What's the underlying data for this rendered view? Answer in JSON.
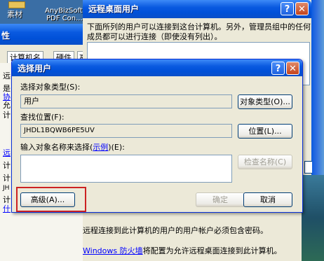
{
  "desktop": {
    "icons": [
      {
        "label": "素材"
      },
      {
        "label_line1": "AnyBizSoft",
        "label_line2": "PDF Con..."
      }
    ]
  },
  "back_window": {
    "title_fragment": "性",
    "tabs": [
      "计算机名",
      "硬件",
      "高"
    ],
    "fragments": [
      "远",
      "是",
      "协",
      "允",
      "计",
      "远",
      "计",
      "计",
      "JH",
      "计",
      "什"
    ]
  },
  "remote_window": {
    "title": "远程桌面用户",
    "help": "?",
    "close": "✕",
    "desc_line1": "下面所列的用户可以连接到这台计算机。另外，管理员组中的任何",
    "desc_line2": "成员都可以进行连接（即使没有列出）。",
    "bottom_line1": "远程连接到此计算机的用户的用户帐户必须包含密码。",
    "bottom_line2_link": "Windows 防火墙",
    "bottom_line2_rest": "将配置为允许远程桌面连接到此计算机。"
  },
  "select_user_dialog": {
    "title": "选择用户",
    "help": "?",
    "close": "✕",
    "object_type_label": "选择对象类型(S):",
    "object_type_value": "用户",
    "object_type_button": "对象类型(O)...",
    "location_label": "查找位置(F):",
    "location_value": "JHDL1BQWB6PE5UV",
    "location_button": "位置(L)...",
    "enter_names_label_pre": "输入对象名称来选择(",
    "enter_names_link": "示例",
    "enter_names_label_post": ")(E):",
    "check_names_button": "检查名称(C)",
    "advanced_button": "高级(A)...",
    "ok_button": "确定",
    "cancel_button": "取消"
  },
  "colors": {
    "highlight": "#cc2222",
    "dialog_bg": "#ece9d8",
    "titlebar": "#0a5ae0"
  }
}
